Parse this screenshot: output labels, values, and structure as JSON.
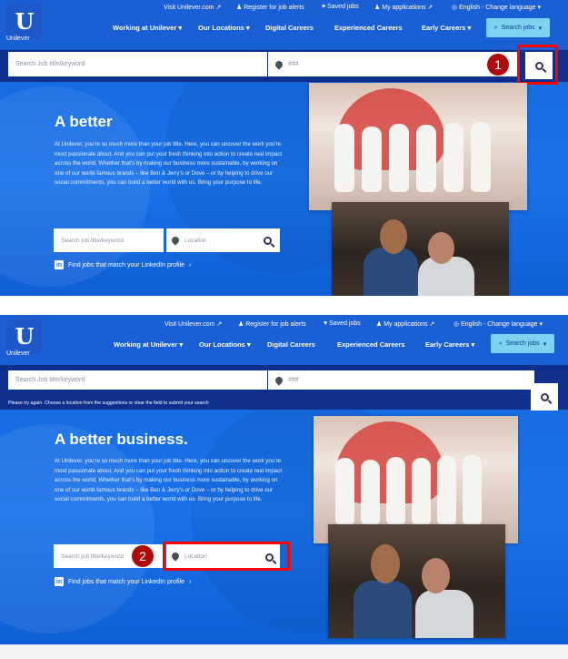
{
  "brand": {
    "name": "Unilever",
    "logo_letter": "U"
  },
  "utility_nav": [
    {
      "label": "Visit Unilever.com"
    },
    {
      "label": "Register for job alerts"
    },
    {
      "label": "Saved jobs"
    },
    {
      "label": "My applications"
    },
    {
      "label": "English - Change language"
    }
  ],
  "main_nav": [
    {
      "label": "Working at Unilever"
    },
    {
      "label": "Our Locations"
    },
    {
      "label": "Digital Careers"
    },
    {
      "label": "Experienced Careers"
    },
    {
      "label": "Early Careers"
    }
  ],
  "search_jobs_button": "Search jobs",
  "top_search": {
    "keyword_placeholder": "Search Job title/keyword",
    "location_value": "###"
  },
  "validation_message": "Please try again. Choose a location from the suggestions or clear the field to submit your search",
  "hero_panel1": {
    "title": "A better",
    "copy": "At Unilever, you're so much more than your job title. Here, you can uncover the work you're most passionate about. And you can put your fresh thinking into action to create real impact across the world. Whether that's by making our business more sustainable, by working on one of our world-famous brands – like Ben & Jerry's or Dove – or by helping to drive our social commitments, you can build a better world with us. Bring your purpose to life."
  },
  "hero_panel2": {
    "title": "A better business.",
    "copy": "At Unilever, you're so much more than your job title. Here, you can uncover the work you're most passionate about. And you can put your fresh thinking into action to create real impact across the world. Whether that's by making our business more sustainable, by working on one of our world-famous brands – like Ben & Jerry's or Dove – or by helping to drive our social commitments, you can build a better world with us. Bring your purpose to life."
  },
  "hero_search": {
    "keyword_placeholder": "Search job title/keyword",
    "location_placeholder": "Location",
    "location_placeholder_focused": "Location"
  },
  "linkedin_link": "Find jobs that match your LinkedIn profile",
  "step_markers": [
    "1",
    "2"
  ],
  "colors": {
    "brand_blue": "#1f70e0",
    "search_bar": "#0e2f8b",
    "search_button": "#7fd3f0",
    "highlight": "#ff0000"
  }
}
